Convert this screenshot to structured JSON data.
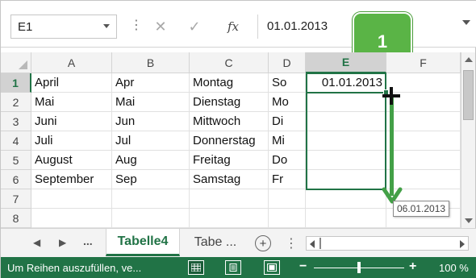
{
  "formula_bar": {
    "name_box": "E1",
    "formula": "01.01.2013",
    "cancel_glyph": "✕",
    "enter_glyph": "✓",
    "fx_glyph": "fx",
    "more_glyph": "⋮"
  },
  "columns": [
    "A",
    "B",
    "C",
    "D",
    "E",
    "F"
  ],
  "rows": [
    "1",
    "2",
    "3",
    "4",
    "5",
    "6",
    "7",
    "8"
  ],
  "cells": {
    "A": [
      "April",
      "Mai",
      "Juni",
      "Juli",
      "August",
      "September"
    ],
    "B": [
      "Apr",
      "Mai",
      "Jun",
      "Jul",
      "Aug",
      "Sep"
    ],
    "C": [
      "Montag",
      "Dienstag",
      "Mittwoch",
      "Donnerstag",
      "Freitag",
      "Samstag"
    ],
    "D": [
      "So",
      "Mo",
      "Di",
      "Mi",
      "Do",
      "Fr"
    ],
    "E1": "01.01.2013"
  },
  "fill_tooltip": "06.01.2013",
  "step_badge": "1",
  "sheet_tabs": {
    "nav_prev": "◀",
    "nav_next": "▶",
    "nav_more": "...",
    "active": "Tabelle4",
    "other": "Tabe ...",
    "add": "+",
    "dots": "⋮"
  },
  "status_bar": {
    "message": "Um Reihen auszufüllen, ve...",
    "zoom_minus": "−",
    "zoom_plus": "+",
    "zoom": "100 %"
  },
  "colors": {
    "accent": "#217346",
    "drag_arrow": "#43a047",
    "badge": "#5ab446"
  },
  "icons": [
    "chevron-down-icon",
    "cancel-icon",
    "enter-icon",
    "function-icon",
    "add-sheet-icon",
    "normal-view-icon",
    "page-layout-icon",
    "page-break-icon",
    "fill-handle-cursor-icon"
  ]
}
